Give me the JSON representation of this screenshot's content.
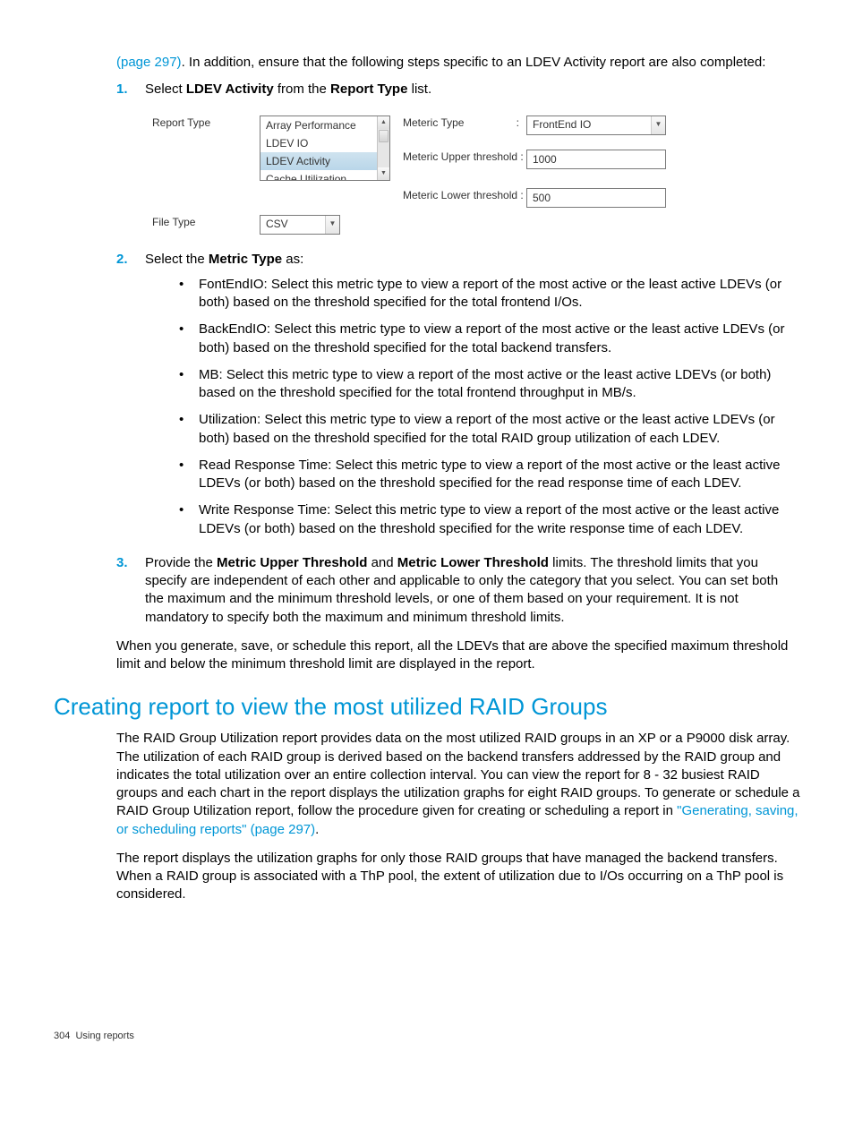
{
  "intro": {
    "link_text": "(page 297)",
    "rest": ". In addition, ensure that the following steps specific to an LDEV Activity report are also completed:"
  },
  "step1": {
    "num": "1.",
    "pre": "Select ",
    "bold1": "LDEV Activity",
    "mid": " from the ",
    "bold2": "Report Type",
    "post": " list."
  },
  "figure": {
    "label_report_type": "Report Type",
    "label_file_type": "File Type",
    "label_metric_type": "Meteric Type",
    "label_metric_type_colon": ":",
    "label_upper": "Meteric Upper threshold :",
    "label_lower": "Meteric Lower threshold :",
    "listbox_items": [
      "Array Performance",
      "LDEV IO",
      "LDEV Activity",
      "Cache Utilization"
    ],
    "file_type_value": "CSV",
    "metric_type_value": "FrontEnd IO",
    "upper_value": "1000",
    "lower_value": "500"
  },
  "step2": {
    "num": "2.",
    "pre": "Select the ",
    "bold": "Metric Type",
    "post": " as:"
  },
  "bullets": [
    "FontEndIO: Select this metric type to view a report of the most active or the least active LDEVs (or both) based on the threshold specified for the total frontend I/Os.",
    "BackEndIO: Select this metric type to view a report of the most active or the least active LDEVs (or both) based on the threshold specified for the total backend transfers.",
    "MB: Select this metric type to view a report of the most active or the least active LDEVs (or both) based on the threshold specified for the total frontend throughput in MB/s.",
    "Utilization: Select this metric type to view a report of the most active or the least active LDEVs (or both) based on the threshold specified for the total RAID group utilization of each LDEV.",
    "Read Response Time: Select this metric type to view a report of the most active or the least active LDEVs (or both) based on the threshold specified for the read response time of each LDEV.",
    "Write Response Time: Select this metric type to view a report of the most active or the least active LDEVs (or both) based on the threshold specified for the write response time of each LDEV."
  ],
  "step3": {
    "num": "3.",
    "pre": "Provide the ",
    "bold1": "Metric Upper Threshold",
    "mid": " and ",
    "bold2": "Metric Lower Threshold",
    "post": " limits. The threshold limits that you specify are independent of each other and applicable to only the category that you select. You can set both the maximum and the minimum threshold levels, or one of them based on your requirement. It is not mandatory to specify both the maximum and minimum threshold limits."
  },
  "after_steps": "When you generate, save, or schedule this report, all the LDEVs that are above the specified maximum threshold limit and below the minimum threshold limit are displayed in the report.",
  "section_heading": "Creating report to view the most utilized RAID Groups",
  "raid_para1_pre": "The RAID Group Utilization report provides data on the most utilized RAID groups in an XP or a P9000 disk array. The utilization of each RAID group is derived based on the backend transfers addressed by the RAID group and indicates the total utilization over an entire collection interval. You can view the report for 8 - 32 busiest RAID groups and each chart in the report displays the utilization graphs for eight RAID groups. To generate or schedule a RAID Group Utilization report, follow the procedure given for creating or scheduling a report in ",
  "raid_para1_link": "\"Generating, saving, or scheduling reports\" (page 297)",
  "raid_para1_post": ".",
  "raid_para2": "The report displays the utilization graphs for only those RAID groups that have managed the backend transfers. When a RAID group is associated with a ThP pool, the extent of utilization due to I/Os occurring on a ThP pool is considered.",
  "footer": {
    "page": "304",
    "section": "Using reports"
  }
}
